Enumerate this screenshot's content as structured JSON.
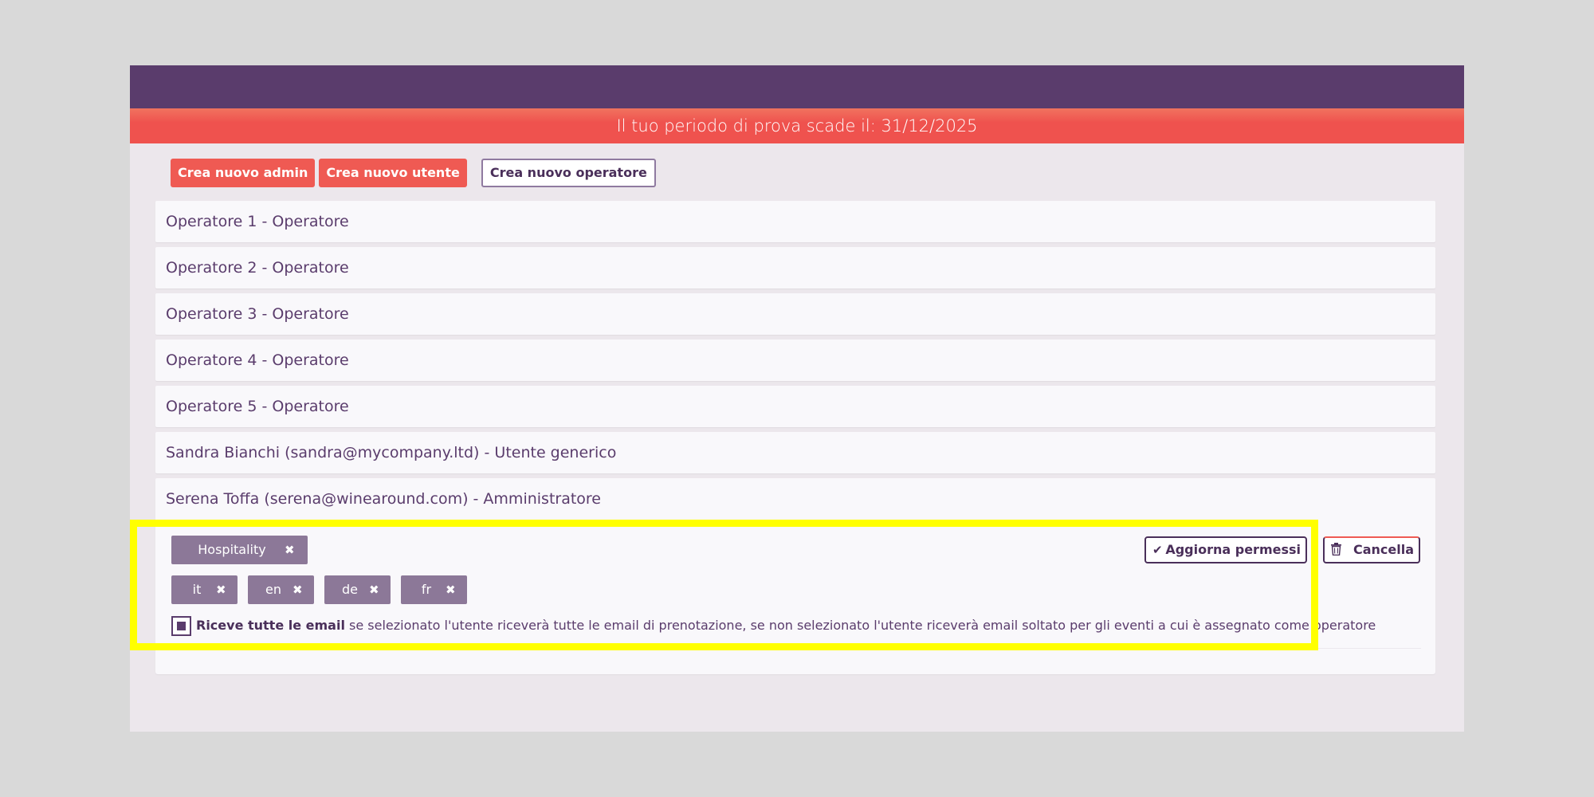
{
  "trial_banner": "Il tuo periodo di prova scade il: 31/12/2025",
  "actions": {
    "new_admin": "Crea nuovo admin",
    "new_user": "Crea nuovo utente",
    "new_operator": "Crea nuovo operatore"
  },
  "users": [
    "Operatore 1 - Operatore",
    "Operatore 2 - Operatore",
    "Operatore 3 - Operatore",
    "Operatore 4 - Operatore",
    "Operatore 5 - Operatore",
    "Sandra Bianchi (sandra@mycompany.ltd) - Utente generico",
    "Serena Toffa (serena@winearound.com) - Amministratore"
  ],
  "detail": {
    "role_tag": "Hospitality",
    "languages": [
      "it",
      "en",
      "de",
      "fr"
    ],
    "remove_icon": "✖",
    "update_button": "Aggiorna permessi",
    "update_icon": "check-icon",
    "delete_button": "Cancella",
    "delete_icon": "trash-icon",
    "checkbox_checked": true,
    "checkbox_label": "Riceve tutte le email",
    "checkbox_desc": " se selezionato l'utente riceverà tutte le email di prenotazione, se non selezionato l'utente riceverà email soltato per gli eventi a cui è assegnato come operatore"
  },
  "colors": {
    "header": "#5a3c6c",
    "banner": "#ef524e",
    "accent_red": "#ef5a53",
    "tag": "#8c7898",
    "highlight": "#ffff00"
  }
}
